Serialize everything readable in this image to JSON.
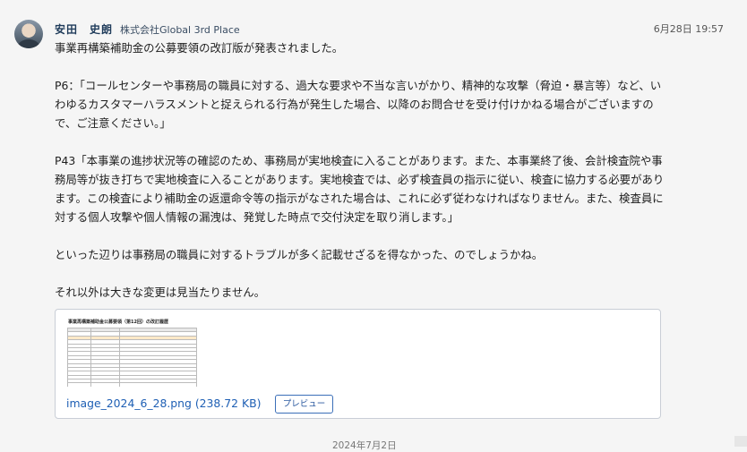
{
  "post": {
    "author": "安田　史朗",
    "company": "株式会社Global 3rd Place",
    "timestamp": "6月28日 19:57",
    "paragraphs": [
      "事業再構築補助金の公募要領の改訂版が発表されました。",
      "",
      "P6：「コールセンターや事務局の職員に対する、過大な要求や不当な言いがかり、精神的な攻撃（脅迫・暴言等）など、いわゆるカスタマーハラスメントと捉えられる行為が発生した場合、以降のお問合せを受け付けかねる場合がございますので、ご注意ください。」",
      "",
      "P43「本事業の進捗状況等の確認のため、事務局が実地検査に入ることがあります。また、本事業終了後、会計検査院や事務局等が抜き打ちで実地検査に入ることがあります。実地検査では、必ず検査員の指示に従い、検査に協力する必要があります。この検査により補助金の返還命令等の指示がなされた場合は、これに必ず従わなければなりません。また、検査員に対する個人攻撃や個人情報の漏洩は、発覚した時点で交付決定を取り消します。」",
      "",
      "といった辺りは事務局の職員に対するトラブルが多く記載せざるを得なかった、のでしょうかね。",
      "",
      "それ以外は大きな変更は見当たりません。"
    ]
  },
  "attachment": {
    "thumbnail_title": "事業再構築補助金公募要領（第12回）の改訂履歴",
    "filename": "image_2024_6_28.png (238.72 KB)",
    "preview_label": "プレビュー"
  },
  "date_divider": "2024年7月2日"
}
